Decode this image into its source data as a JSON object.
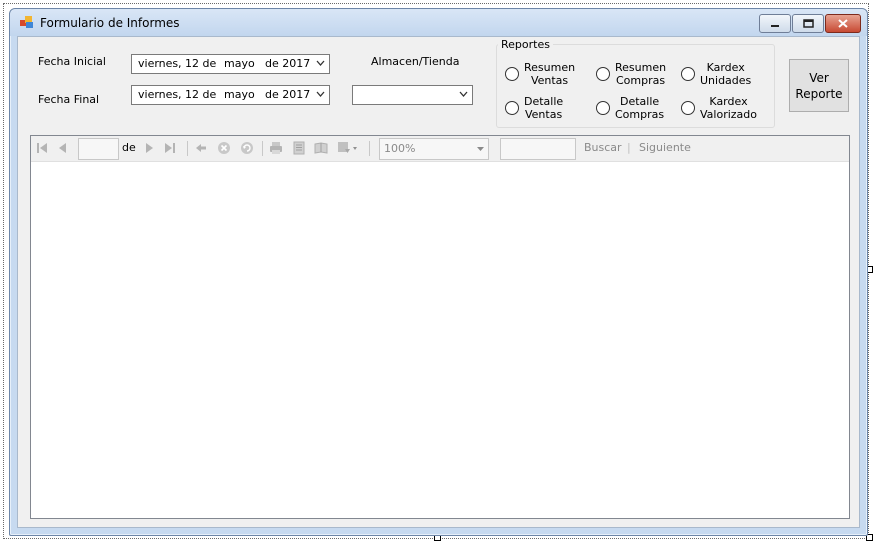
{
  "window": {
    "title": "Formulario de Informes",
    "buttons": [
      "minimize",
      "maximize",
      "close"
    ]
  },
  "filters": {
    "fecha_inicial_label": "Fecha Inicial",
    "fecha_final_label": "Fecha Final",
    "fecha_inicial": {
      "weekday": "viernes",
      "day": ", 12 de",
      "month": "mayo",
      "year": "de 2017"
    },
    "fecha_final": {
      "weekday": "viernes",
      "day": ", 12 de",
      "month": "mayo",
      "year": "de 2017"
    },
    "almacen_label": "Almacen/Tienda",
    "almacen_value": ""
  },
  "reportes": {
    "title": "Reportes",
    "options": [
      {
        "line1": "Resumen",
        "line2": "Ventas"
      },
      {
        "line1": "Resumen",
        "line2": "Compras"
      },
      {
        "line1": "Kardex",
        "line2": "Unidades"
      },
      {
        "line1": "Detalle",
        "line2": "Ventas"
      },
      {
        "line1": "Detalle",
        "line2": "Compras"
      },
      {
        "line1": "Kardex",
        "line2": "Valorizado"
      }
    ]
  },
  "ver_reporte": {
    "line1": "Ver",
    "line2": "Reporte"
  },
  "toolbar": {
    "page_current": "",
    "of_label": "de",
    "zoom": "100%",
    "search_value": "",
    "buscar_label": "Buscar",
    "separator": "|",
    "siguiente_label": "Siguiente"
  },
  "colors": {
    "window_frame": "#c7daf0",
    "client_bg": "#f0f0f0",
    "close_button": "#c74a33",
    "disabled_icon": "#b4b4b4"
  },
  "icons": [
    "first-page-icon",
    "previous-page-icon",
    "next-page-icon",
    "last-page-icon",
    "back-icon",
    "stop-icon",
    "refresh-icon",
    "print-icon",
    "print-layout-icon",
    "page-setup-icon",
    "export-icon"
  ]
}
